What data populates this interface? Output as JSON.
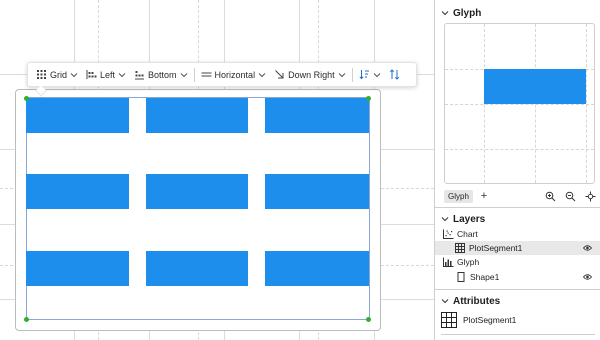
{
  "toolbar": {
    "layout_label": "Grid",
    "h_align_label": "Left",
    "v_align_label": "Bottom",
    "orientation_label": "Horizontal",
    "direction_label": "Down Right"
  },
  "chart": {
    "bar_color": "#1e8eed",
    "handle_color": "#2db12d",
    "rows": 3,
    "columns": 3
  },
  "glyph_panel": {
    "title": "Glyph",
    "tab_label": "Glyph",
    "add_label": "+"
  },
  "layers_panel": {
    "title": "Layers",
    "items": [
      {
        "label": "Chart"
      },
      {
        "label": "PlotSegment1"
      },
      {
        "label": "Glyph"
      },
      {
        "label": "Shape1"
      }
    ]
  },
  "attributes_panel": {
    "title": "Attributes",
    "selected_label": "PlotSegment1"
  }
}
